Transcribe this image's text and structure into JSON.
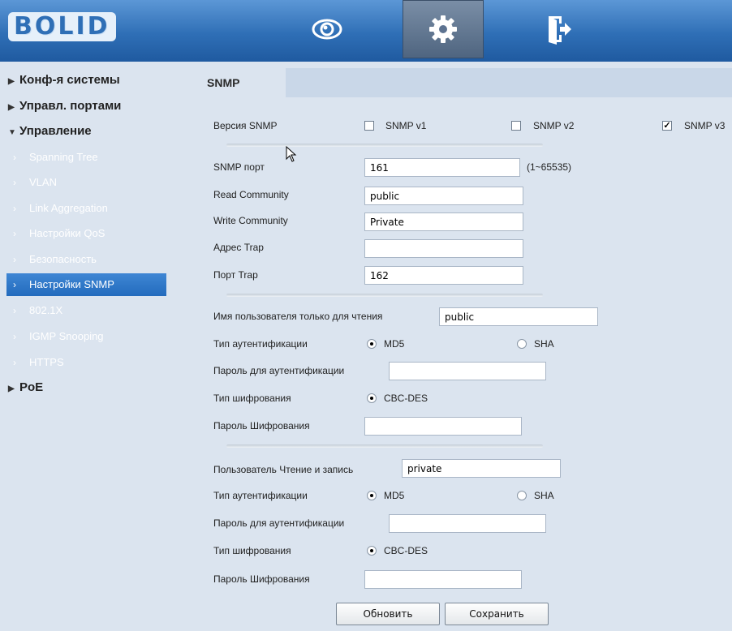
{
  "header": {
    "logo": "BOLID",
    "icons": [
      "eye-icon",
      "gear-icon",
      "exit-icon"
    ],
    "accent": "#2f6fb6"
  },
  "sidebar": {
    "sections": [
      {
        "label": "Конф-я системы"
      },
      {
        "label": "Управл. портами"
      },
      {
        "label": "Управление"
      },
      {
        "label": "PoE"
      }
    ],
    "items": [
      {
        "label": "Spanning Tree"
      },
      {
        "label": "VLAN"
      },
      {
        "label": "Link Aggregation"
      },
      {
        "label": "Настройки QoS"
      },
      {
        "label": "Безопасность"
      },
      {
        "label": "Настройки SNMP"
      },
      {
        "label": "802.1X"
      },
      {
        "label": "IGMP Snooping"
      },
      {
        "label": "HTTPS"
      }
    ],
    "active_item": "Настройки SNMP",
    "active_color": "#2d74c6"
  },
  "tab": {
    "label": "SNMP"
  },
  "form": {
    "version_label": "Версия SNMP",
    "versions": [
      {
        "label": "SNMP v1",
        "checked": false
      },
      {
        "label": "SNMP v2",
        "checked": false
      },
      {
        "label": "SNMP v3",
        "checked": true
      }
    ],
    "snmp_port_label": "SNMP порт",
    "snmp_port_value": "161",
    "snmp_port_range": "(1~65535)",
    "read_community_label": "Read Community",
    "read_community_value": "public",
    "write_community_label": "Write Community",
    "write_community_value": "Private",
    "trap_address_label": "Адрес Trap",
    "trap_address_value": "",
    "trap_port_label": "Порт Trap",
    "trap_port_value": "162",
    "readonly_user": {
      "user_label": "Имя пользователя только для чтения",
      "user_value": "public",
      "auth_type_label": "Тип аутентификации",
      "auth_options": [
        "MD5",
        "SHA"
      ],
      "auth_selected": "MD5",
      "auth_password_label": "Пароль для аутентификации",
      "auth_password_value": "",
      "enc_type_label": "Тип шифрования",
      "enc_option": "CBC-DES",
      "enc_password_label": "Пароль Шифрования",
      "enc_password_value": ""
    },
    "readwrite_user": {
      "user_label": "Пользователь Чтение и запись",
      "user_value": "private",
      "auth_type_label": "Тип аутентификации",
      "auth_options": [
        "MD5",
        "SHA"
      ],
      "auth_selected": "MD5",
      "auth_password_label": "Пароль для аутентификации",
      "auth_password_value": "",
      "enc_type_label": "Тип шифрования",
      "enc_option": "CBC-DES",
      "enc_password_label": "Пароль Шифрования",
      "enc_password_value": ""
    },
    "refresh_button": "Обновить",
    "save_button": "Сохранить"
  }
}
